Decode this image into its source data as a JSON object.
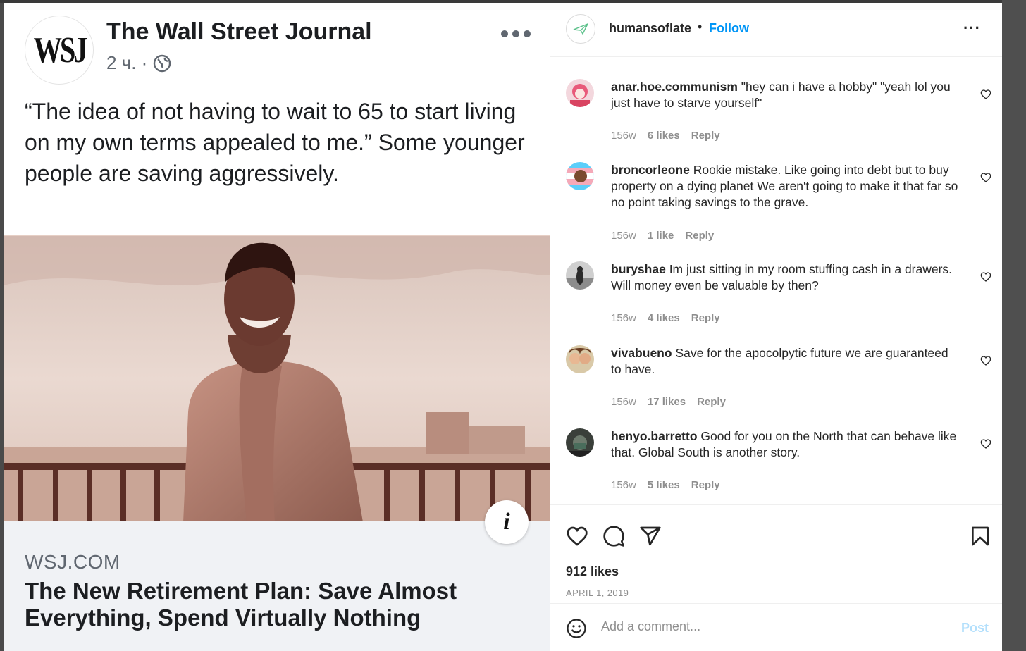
{
  "fb_post": {
    "logo_text": "WSJ",
    "page_name": "The Wall Street Journal",
    "time": "2 ч. ·",
    "quote": "“The idea of not having to wait to 65 to start living on my own terms appealed to me.” Some younger people are saving aggressively.",
    "link": {
      "domain": "WSJ.COM",
      "title": "The New Retirement Plan: Save Almost Everything, Spend Virtually Nothing"
    }
  },
  "instagram": {
    "header": {
      "username": "humansoflate",
      "separator": "•",
      "follow_label": "Follow",
      "more_label": "···"
    },
    "comments": [
      {
        "user": "anar.hoe.communism",
        "text": "\"hey can i have a hobby\" \"yeah lol you just have to starve yourself\"",
        "time": "156w",
        "likes": "6 likes",
        "reply": "Reply"
      },
      {
        "user": "broncorleone",
        "text": "Rookie mistake. Like going into debt but to buy property on a dying planet We aren't going to make it that far so no point taking savings to the grave.",
        "time": "156w",
        "likes": "1 like",
        "reply": "Reply"
      },
      {
        "user": "buryshae",
        "text": "Im just sitting in my room stuffing cash in a drawers. Will money even be valuable by then?",
        "time": "156w",
        "likes": "4 likes",
        "reply": "Reply"
      },
      {
        "user": "vivabueno",
        "text": "Save for the apocolpytic future we are guaranteed to have.",
        "time": "156w",
        "likes": "17 likes",
        "reply": "Reply"
      },
      {
        "user": "henyo.barretto",
        "text": "Good for you on the North that can behave like that. Global South is another story.",
        "time": "156w",
        "likes": "5 likes",
        "reply": "Reply"
      }
    ],
    "likes": "912 likes",
    "date": "APRIL 1, 2019",
    "add_comment_placeholder": "Add a comment...",
    "post_label": "Post",
    "colors": {
      "follow": "#0095f6",
      "post_disabled": "#b2dffc",
      "text": "#262626",
      "muted": "#8e8e8e"
    }
  }
}
